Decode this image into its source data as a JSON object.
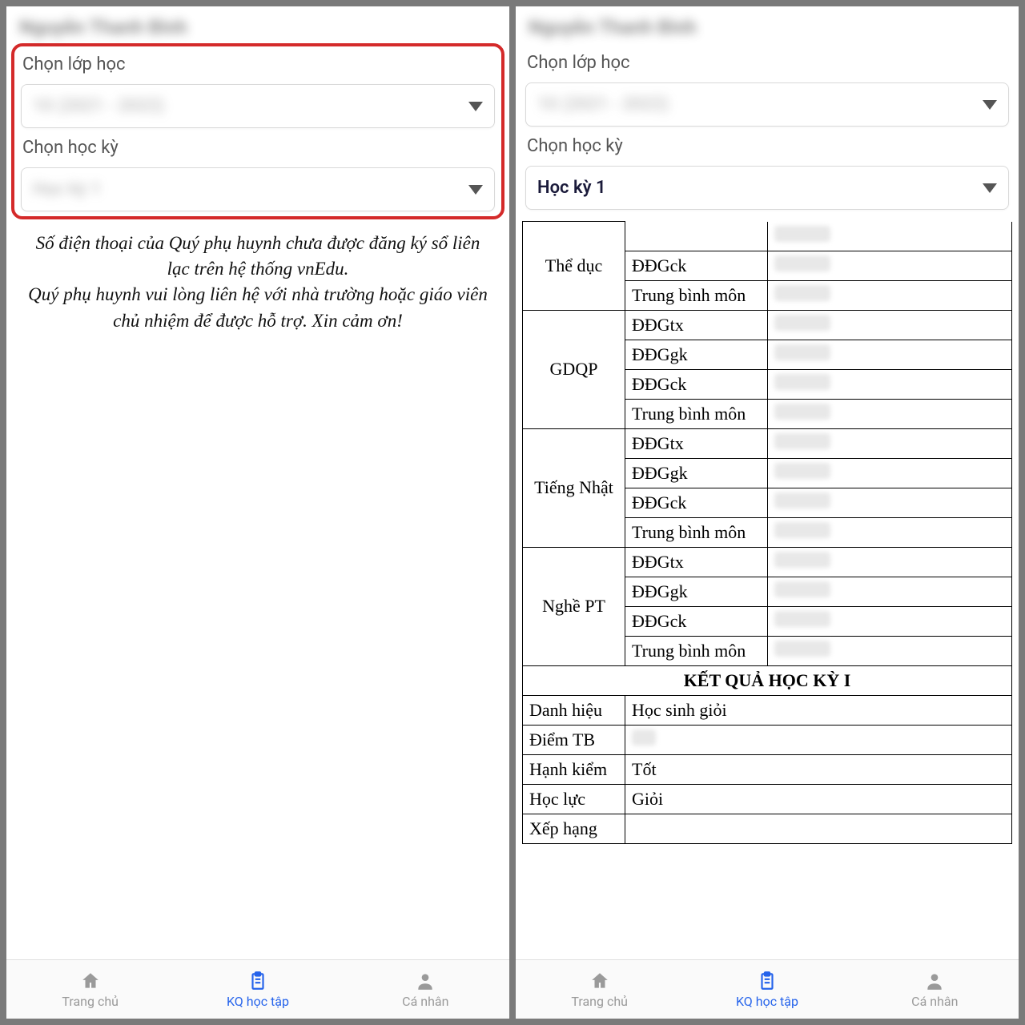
{
  "left": {
    "student_name": "Nguyễn  Thanh  Bình",
    "class_label": "Chọn lớp học",
    "class_value": "10  (2021 - 2022)",
    "semester_label": "Chọn học kỳ",
    "semester_value": "Học kỳ 1",
    "message_line1": "Số điện thoại của Quý phụ huynh chưa được đăng ký sổ liên lạc trên hệ thống vnEdu.",
    "message_line2": "Quý phụ huynh vui lòng liên hệ với nhà trường hoặc giáo viên chủ nhiệm để được hỗ trợ. Xin cảm ơn!"
  },
  "right": {
    "student_name": "Nguyễn  Thanh  Bình",
    "class_label": "Chọn lớp học",
    "class_value": "10  (2021 - 2022)",
    "semester_label": "Chọn học kỳ",
    "semester_value": "Học kỳ 1",
    "subjects": [
      {
        "name": "Thể dục",
        "rows": [
          "ĐĐGck",
          "Trung bình môn"
        ]
      },
      {
        "name": "GDQP",
        "rows": [
          "ĐĐGtx",
          "ĐĐGgk",
          "ĐĐGck",
          "Trung bình môn"
        ]
      },
      {
        "name": "Tiếng Nhật",
        "rows": [
          "ĐĐGtx",
          "ĐĐGgk",
          "ĐĐGck",
          "Trung bình môn"
        ]
      },
      {
        "name": "Nghề PT",
        "rows": [
          "ĐĐGtx",
          "ĐĐGgk",
          "ĐĐGck",
          "Trung bình môn"
        ]
      }
    ],
    "summary_header": "KẾT QUẢ HỌC KỲ I",
    "summary": [
      {
        "label": "Danh hiệu",
        "value": "Học sinh giỏi"
      },
      {
        "label": "Điểm TB",
        "value": ""
      },
      {
        "label": "Hạnh kiểm",
        "value": "Tốt"
      },
      {
        "label": "Học lực",
        "value": "Giỏi"
      },
      {
        "label": "Xếp hạng",
        "value": ""
      }
    ]
  },
  "nav": {
    "home": "Trang chủ",
    "results": "KQ học tập",
    "profile": "Cá nhân"
  }
}
